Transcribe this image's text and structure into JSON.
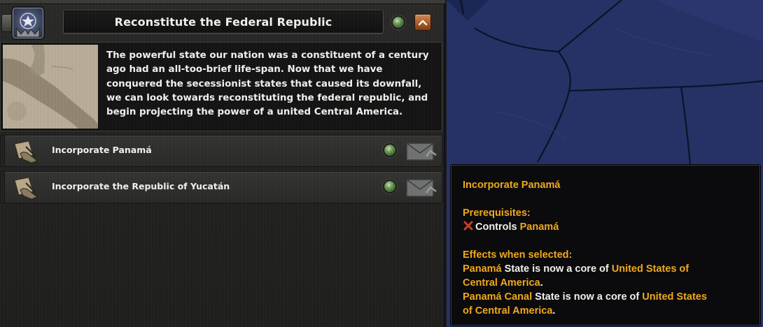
{
  "decision_category": {
    "title": "Reconstitute the Federal Republic",
    "description": "The powerful state our nation was a constituent of a century ago had an all-too-brief life-span. Now that we have conquered the secessionist states that caused its downfall, we can look towards reconstituting the federal republic, and begin projecting the power of a united Central America."
  },
  "decisions": [
    {
      "label": "Incorporate Panamá"
    },
    {
      "label": "Incorporate the Republic of Yucatán"
    }
  ],
  "tooltip": {
    "title": "Incorporate Panamá",
    "prerequisites_heading": "Prerequisites:",
    "prerequisite": {
      "text": "Controls ",
      "highlight": "Panamá"
    },
    "effects_heading": "Effects when selected:",
    "effect_1": {
      "state": "Panamá",
      "text": " State is now a core of ",
      "country_line1": "United States of",
      "country_line2": "Central America",
      "end": "."
    },
    "effect_2": {
      "state": "Panamá Canal",
      "text": " State is now a core of ",
      "country_line1": "United States",
      "country_line2": "of Central America",
      "end": "."
    }
  },
  "colors": {
    "highlight": "#f0a81c",
    "status_green": "#6e9a57",
    "map_water": "#243062"
  },
  "icons": {
    "category_emblem": "federal-emblem-icon",
    "collapse": "chevron-up-icon",
    "decision": "document-hand-icon",
    "send": "envelope-icon",
    "failed": "x-mark-icon"
  }
}
